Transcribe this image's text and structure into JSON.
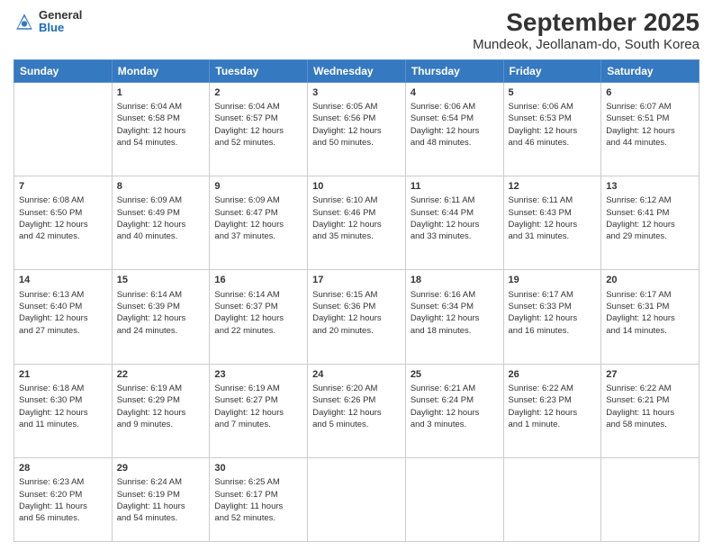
{
  "header": {
    "logo_general": "General",
    "logo_blue": "Blue",
    "title": "September 2025",
    "subtitle": "Mundeok, Jeollanam-do, South Korea"
  },
  "days": [
    "Sunday",
    "Monday",
    "Tuesday",
    "Wednesday",
    "Thursday",
    "Friday",
    "Saturday"
  ],
  "weeks": [
    [
      {
        "day": "",
        "content": ""
      },
      {
        "day": "1",
        "content": "Sunrise: 6:04 AM\nSunset: 6:58 PM\nDaylight: 12 hours\nand 54 minutes."
      },
      {
        "day": "2",
        "content": "Sunrise: 6:04 AM\nSunset: 6:57 PM\nDaylight: 12 hours\nand 52 minutes."
      },
      {
        "day": "3",
        "content": "Sunrise: 6:05 AM\nSunset: 6:56 PM\nDaylight: 12 hours\nand 50 minutes."
      },
      {
        "day": "4",
        "content": "Sunrise: 6:06 AM\nSunset: 6:54 PM\nDaylight: 12 hours\nand 48 minutes."
      },
      {
        "day": "5",
        "content": "Sunrise: 6:06 AM\nSunset: 6:53 PM\nDaylight: 12 hours\nand 46 minutes."
      },
      {
        "day": "6",
        "content": "Sunrise: 6:07 AM\nSunset: 6:51 PM\nDaylight: 12 hours\nand 44 minutes."
      }
    ],
    [
      {
        "day": "7",
        "content": "Sunrise: 6:08 AM\nSunset: 6:50 PM\nDaylight: 12 hours\nand 42 minutes."
      },
      {
        "day": "8",
        "content": "Sunrise: 6:09 AM\nSunset: 6:49 PM\nDaylight: 12 hours\nand 40 minutes."
      },
      {
        "day": "9",
        "content": "Sunrise: 6:09 AM\nSunset: 6:47 PM\nDaylight: 12 hours\nand 37 minutes."
      },
      {
        "day": "10",
        "content": "Sunrise: 6:10 AM\nSunset: 6:46 PM\nDaylight: 12 hours\nand 35 minutes."
      },
      {
        "day": "11",
        "content": "Sunrise: 6:11 AM\nSunset: 6:44 PM\nDaylight: 12 hours\nand 33 minutes."
      },
      {
        "day": "12",
        "content": "Sunrise: 6:11 AM\nSunset: 6:43 PM\nDaylight: 12 hours\nand 31 minutes."
      },
      {
        "day": "13",
        "content": "Sunrise: 6:12 AM\nSunset: 6:41 PM\nDaylight: 12 hours\nand 29 minutes."
      }
    ],
    [
      {
        "day": "14",
        "content": "Sunrise: 6:13 AM\nSunset: 6:40 PM\nDaylight: 12 hours\nand 27 minutes."
      },
      {
        "day": "15",
        "content": "Sunrise: 6:14 AM\nSunset: 6:39 PM\nDaylight: 12 hours\nand 24 minutes."
      },
      {
        "day": "16",
        "content": "Sunrise: 6:14 AM\nSunset: 6:37 PM\nDaylight: 12 hours\nand 22 minutes."
      },
      {
        "day": "17",
        "content": "Sunrise: 6:15 AM\nSunset: 6:36 PM\nDaylight: 12 hours\nand 20 minutes."
      },
      {
        "day": "18",
        "content": "Sunrise: 6:16 AM\nSunset: 6:34 PM\nDaylight: 12 hours\nand 18 minutes."
      },
      {
        "day": "19",
        "content": "Sunrise: 6:17 AM\nSunset: 6:33 PM\nDaylight: 12 hours\nand 16 minutes."
      },
      {
        "day": "20",
        "content": "Sunrise: 6:17 AM\nSunset: 6:31 PM\nDaylight: 12 hours\nand 14 minutes."
      }
    ],
    [
      {
        "day": "21",
        "content": "Sunrise: 6:18 AM\nSunset: 6:30 PM\nDaylight: 12 hours\nand 11 minutes."
      },
      {
        "day": "22",
        "content": "Sunrise: 6:19 AM\nSunset: 6:29 PM\nDaylight: 12 hours\nand 9 minutes."
      },
      {
        "day": "23",
        "content": "Sunrise: 6:19 AM\nSunset: 6:27 PM\nDaylight: 12 hours\nand 7 minutes."
      },
      {
        "day": "24",
        "content": "Sunrise: 6:20 AM\nSunset: 6:26 PM\nDaylight: 12 hours\nand 5 minutes."
      },
      {
        "day": "25",
        "content": "Sunrise: 6:21 AM\nSunset: 6:24 PM\nDaylight: 12 hours\nand 3 minutes."
      },
      {
        "day": "26",
        "content": "Sunrise: 6:22 AM\nSunset: 6:23 PM\nDaylight: 12 hours\nand 1 minute."
      },
      {
        "day": "27",
        "content": "Sunrise: 6:22 AM\nSunset: 6:21 PM\nDaylight: 11 hours\nand 58 minutes."
      }
    ],
    [
      {
        "day": "28",
        "content": "Sunrise: 6:23 AM\nSunset: 6:20 PM\nDaylight: 11 hours\nand 56 minutes."
      },
      {
        "day": "29",
        "content": "Sunrise: 6:24 AM\nSunset: 6:19 PM\nDaylight: 11 hours\nand 54 minutes."
      },
      {
        "day": "30",
        "content": "Sunrise: 6:25 AM\nSunset: 6:17 PM\nDaylight: 11 hours\nand 52 minutes."
      },
      {
        "day": "",
        "content": ""
      },
      {
        "day": "",
        "content": ""
      },
      {
        "day": "",
        "content": ""
      },
      {
        "day": "",
        "content": ""
      }
    ]
  ]
}
